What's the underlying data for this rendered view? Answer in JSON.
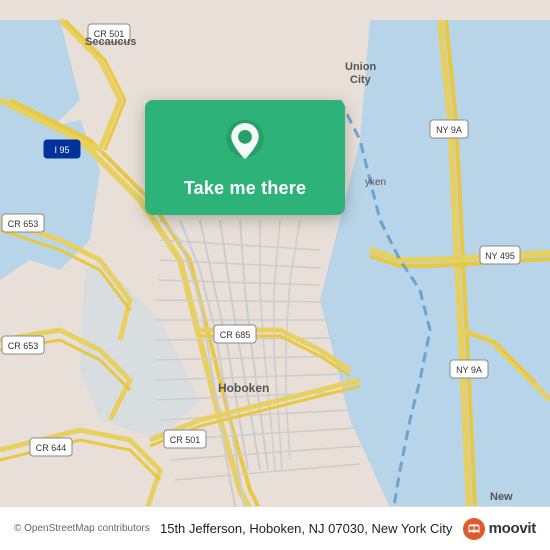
{
  "map": {
    "background_color": "#e8e0d8"
  },
  "card": {
    "button_label": "Take me there",
    "background_color": "#2db37a"
  },
  "bottom_bar": {
    "attribution": "© OpenStreetMap contributors",
    "address": "15th Jefferson, Hoboken, NJ 07030, New York City",
    "moovit_label": "moovit"
  }
}
